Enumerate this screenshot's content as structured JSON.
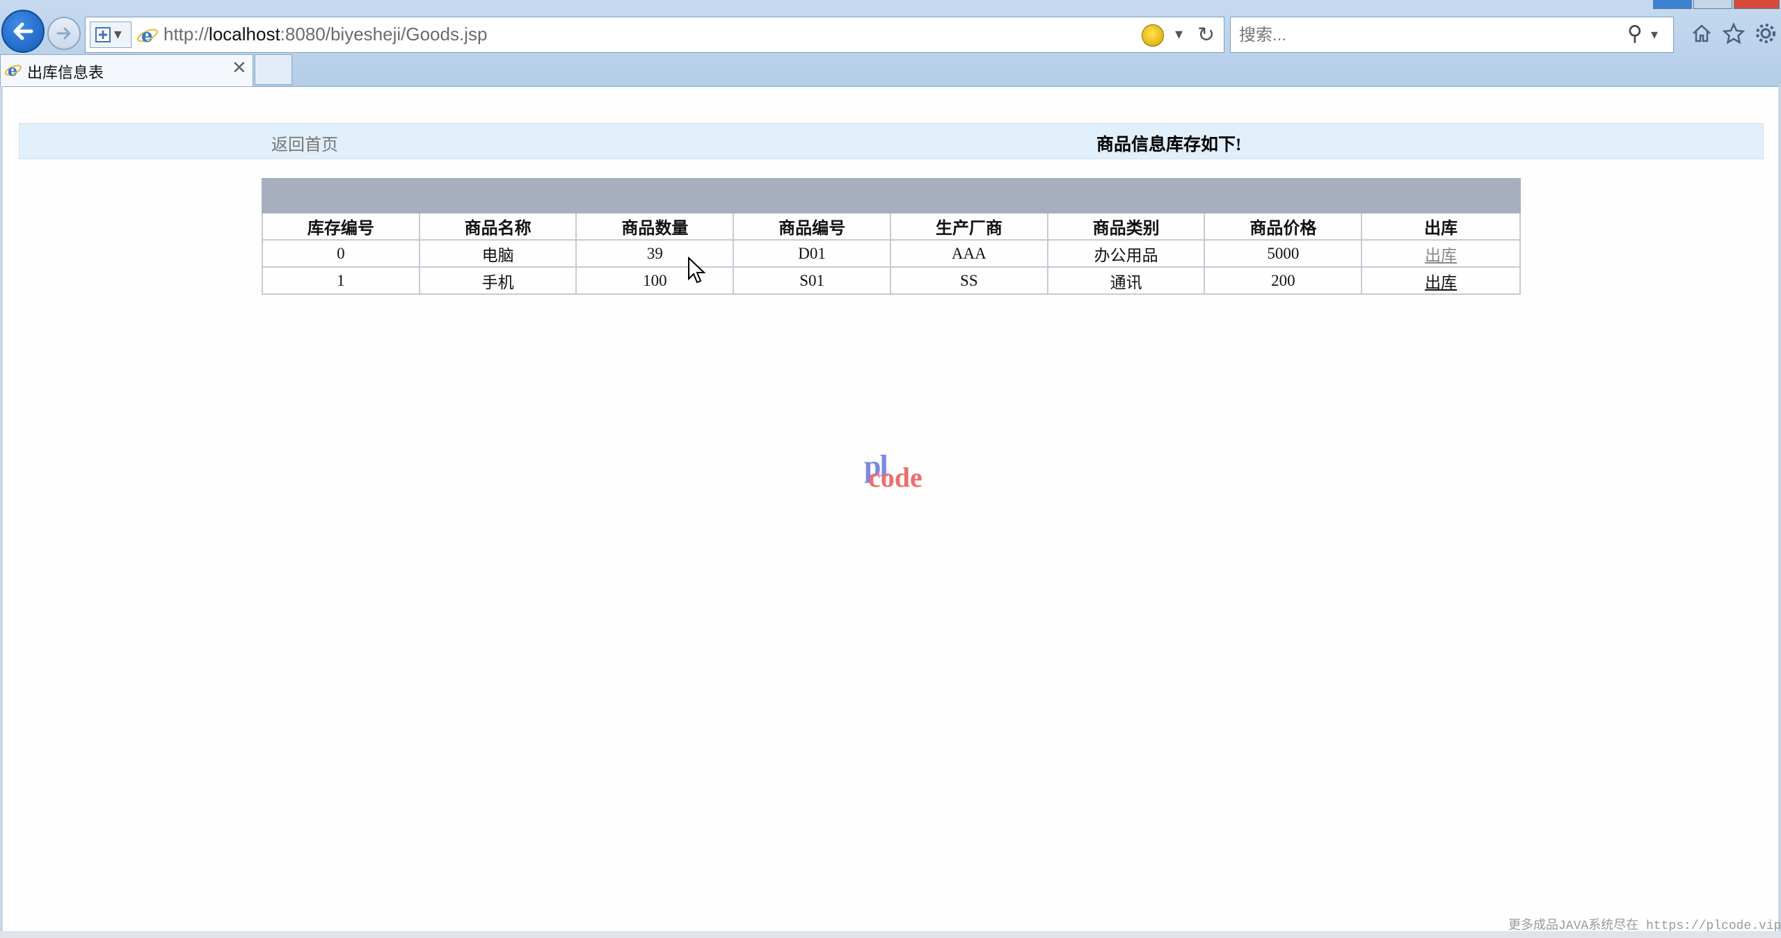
{
  "browser": {
    "url_prefix": "http://",
    "url_host": "localhost",
    "url_rest": ":8080/biyesheji/Goods.jsp",
    "search_placeholder": "搜索...",
    "tab_title": "出库信息表"
  },
  "page": {
    "home_link": "返回首页",
    "heading": "商品信息库存如下!",
    "table": {
      "columns": [
        "库存编号",
        "商品名称",
        "商品数量",
        "商品编号",
        "生产厂商",
        "商品类别",
        "商品价格",
        "出库"
      ],
      "rows": [
        [
          "0",
          "电脑",
          "39",
          "D01",
          "AAA",
          "办公用品",
          "5000",
          "出库"
        ],
        [
          "1",
          "手机",
          "100",
          "S01",
          "SS",
          "通讯",
          "200",
          "出库"
        ]
      ]
    },
    "watermark_pl": "pl",
    "watermark_code": "code",
    "footer": "更多成品JAVA系统尽在 https://plcode.vip"
  },
  "colors": {
    "header_band": "#a7aebd",
    "topbar": "#e1effa",
    "chrome": "#b4cde8"
  }
}
